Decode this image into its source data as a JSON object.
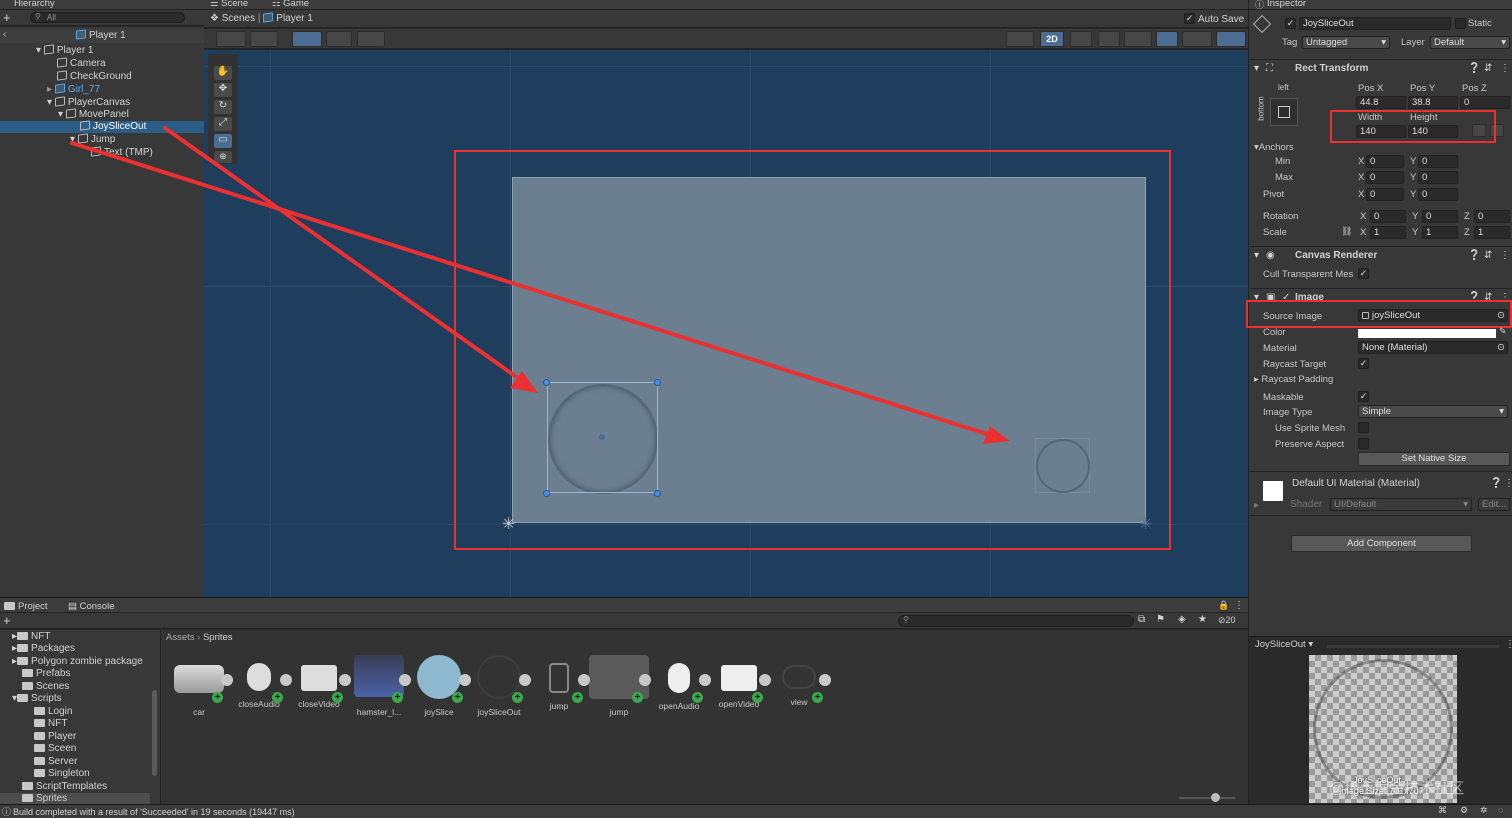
{
  "hierarchy": {
    "tab": "Hierarchy",
    "search_placeholder": "All",
    "scene_root": "Player 1",
    "items": [
      {
        "label": "Player 1",
        "depth": 1
      },
      {
        "label": "Camera",
        "depth": 2
      },
      {
        "label": "CheckGround",
        "depth": 2
      },
      {
        "label": "Girl_77",
        "depth": 2
      },
      {
        "label": "PlayerCanvas",
        "depth": 2
      },
      {
        "label": "MovePanel",
        "depth": 3
      },
      {
        "label": "JoySliceOut",
        "depth": 4
      },
      {
        "label": "Jump",
        "depth": 3
      },
      {
        "label": "Text (TMP)",
        "depth": 4
      }
    ]
  },
  "scene": {
    "tabs": [
      "Scene",
      "Game"
    ],
    "breadcrumb_root": "Scenes",
    "breadcrumb_current": "Player 1",
    "auto_save": "Auto Save",
    "mode_2d": "2D"
  },
  "inspector": {
    "tab": "Inspector",
    "object_name": "JoySliceOut",
    "static_label": "Static",
    "tag_label": "Tag",
    "tag_value": "Untagged",
    "layer_label": "Layer",
    "layer_value": "Default",
    "rect_transform": {
      "title": "Rect Transform",
      "anchor_h": "left",
      "anchor_v": "bottom",
      "posx_label": "Pos X",
      "posx": "44.8",
      "posy_label": "Pos Y",
      "posy": "38.8",
      "posz_label": "Pos Z",
      "posz": "0",
      "width_label": "Width",
      "width": "140",
      "height_label": "Height",
      "height": "140",
      "anchors": "Anchors",
      "min": "Min",
      "max": "Max",
      "pivot": "Pivot",
      "min_x": "0",
      "min_y": "0",
      "max_x": "0",
      "max_y": "0",
      "pivot_x": "0",
      "pivot_y": "0",
      "rotation": "Rotation",
      "rot_x": "0",
      "rot_y": "0",
      "rot_z": "0",
      "scale": "Scale",
      "scale_x": "1",
      "scale_y": "1",
      "scale_z": "1",
      "x": "X",
      "y": "Y",
      "z": "Z"
    },
    "canvas_renderer": {
      "title": "Canvas Renderer",
      "cull": "Cull Transparent Mes"
    },
    "image": {
      "title": "Image",
      "source_image_label": "Source Image",
      "source_image": "joySliceOut",
      "color_label": "Color",
      "material_label": "Material",
      "material": "None (Material)",
      "raycast_target": "Raycast Target",
      "raycast_padding": "Raycast Padding",
      "maskable": "Maskable",
      "image_type_label": "Image Type",
      "image_type": "Simple",
      "use_sprite_mesh": "Use Sprite Mesh",
      "preserve_aspect": "Preserve Aspect",
      "set_native_size": "Set Native Size"
    },
    "material_block": {
      "title": "Default UI Material (Material)",
      "shader_label": "Shader",
      "shader": "UI/Default",
      "edit": "Edit..."
    },
    "add_component": "Add Component",
    "preview_title": "JoySliceOut",
    "preview_name": "JoySliceOut",
    "preview_size": "Image Size: 707x707",
    "watermark": "@稀土掘金技术社区"
  },
  "project": {
    "tabs": [
      "Project",
      "Console"
    ],
    "hidden_count": "20",
    "breadcrumb_root": "Assets",
    "breadcrumb_current": "Sprites",
    "folders": [
      "NFT",
      "Packages",
      "Polygon zombie package",
      "Prefabs",
      "Scenes",
      "Scripts",
      "Login",
      "NFT",
      "Player",
      "Sceen",
      "Server",
      "Singleton",
      "ScriptTemplates",
      "Sprites"
    ],
    "assets": [
      "car",
      "closeAudio",
      "closeVideo",
      "hamster_l...",
      "joySlice",
      "joySliceOut",
      "jump",
      "jump",
      "openAudio",
      "openVideo",
      "view"
    ]
  },
  "status": {
    "message": "Build completed with a result of 'Succeeded' in 19 seconds (19447 ms)"
  },
  "colors": {
    "accent": "#2c5d87",
    "annotation": "#ea3030",
    "scene_bg": "#1f3d5c",
    "panel_bg": "#6b7f90"
  }
}
